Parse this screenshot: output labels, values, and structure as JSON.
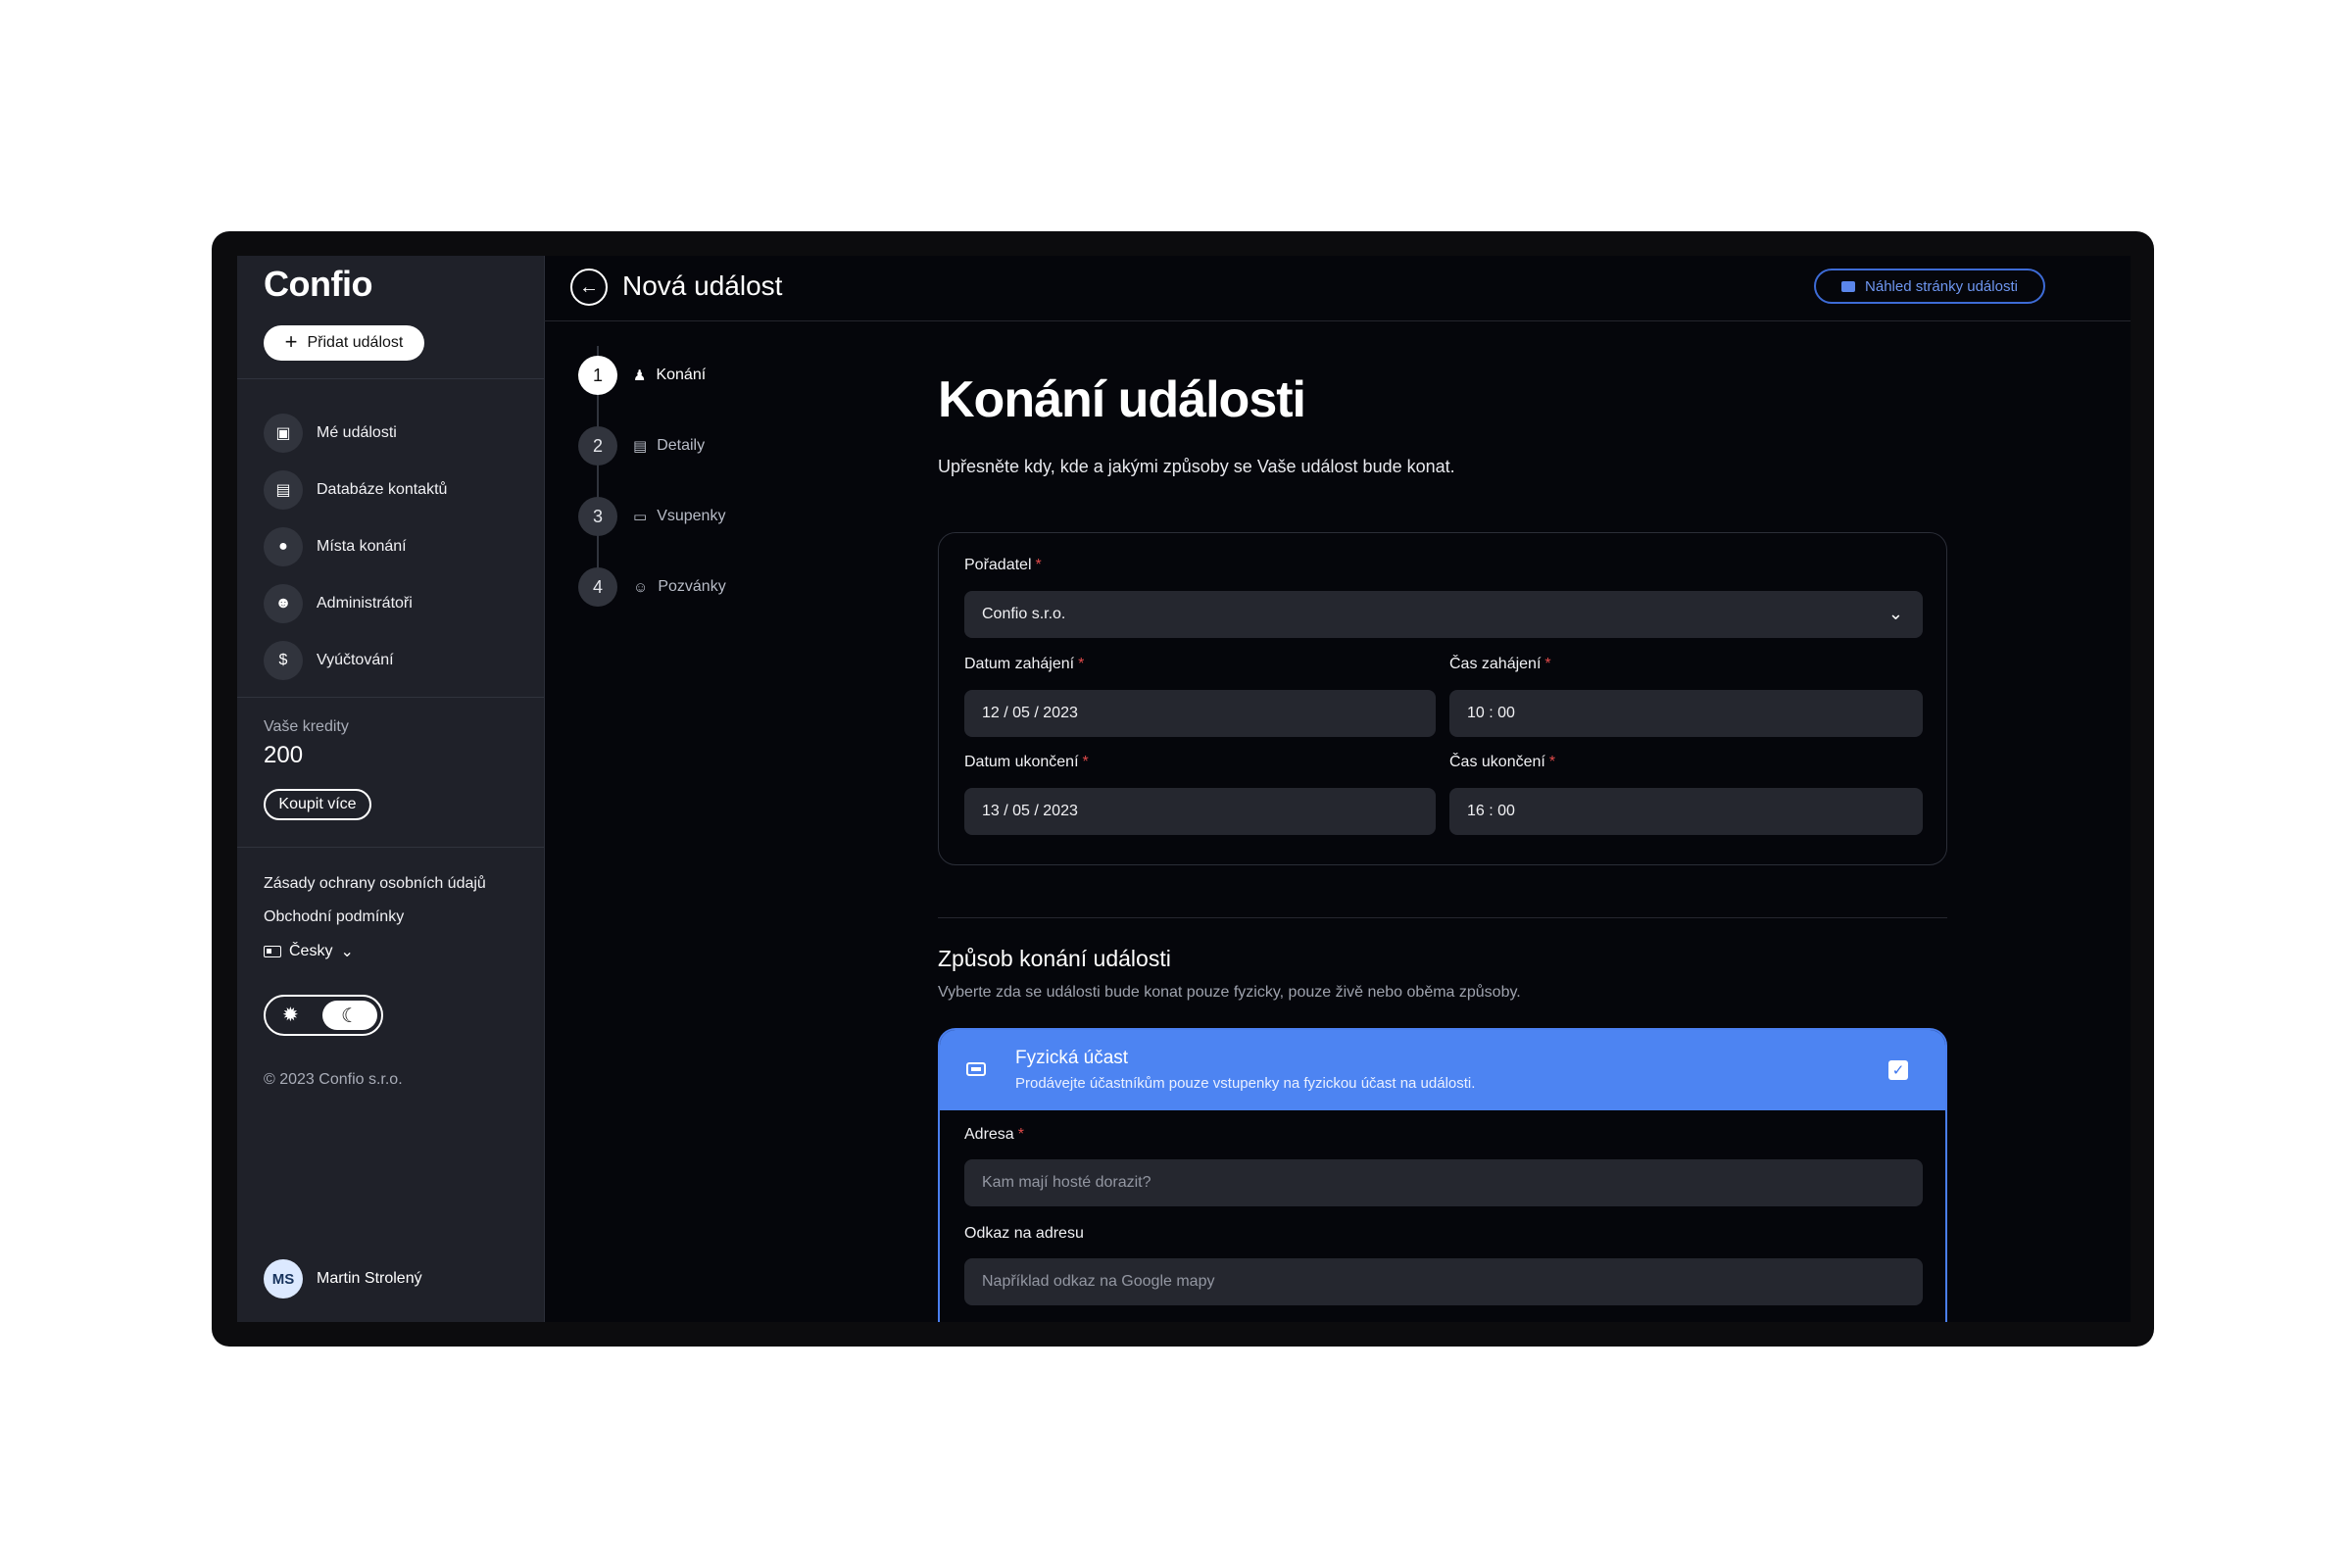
{
  "sidebar": {
    "logo": "Confio",
    "add_event_label": "Přidat událost",
    "nav": [
      {
        "label": "Mé události",
        "icon": "calendar-icon"
      },
      {
        "label": "Databáze kontaktů",
        "icon": "contacts-icon"
      },
      {
        "label": "Místa konání",
        "icon": "location-pin-icon"
      },
      {
        "label": "Administrátoři",
        "icon": "admin-user-icon"
      },
      {
        "label": "Vyúčtování",
        "icon": "dollar-icon"
      }
    ],
    "credits_label": "Vaše kredity",
    "credits_value": "200",
    "buy_more_label": "Koupit více",
    "privacy_link": "Zásady ochrany osobních údajů",
    "terms_link": "Obchodní podmínky",
    "language": "Česky",
    "copyright": "© 2023 Confio s.r.o.",
    "user": {
      "initials": "MS",
      "name": "Martin Strolený"
    }
  },
  "header": {
    "title": "Nová událost",
    "preview_label": "Náhled stránky události"
  },
  "steps": [
    {
      "number": "1",
      "label": "Konání",
      "active": true
    },
    {
      "number": "2",
      "label": "Detaily",
      "active": false
    },
    {
      "number": "3",
      "label": "Vsupenky",
      "active": false
    },
    {
      "number": "4",
      "label": "Pozvánky",
      "active": false
    }
  ],
  "main": {
    "title": "Konání události",
    "description": "Upřesněte kdy, kde a jakými způsoby se Vaše událost bude konat.",
    "organizer_label": "Pořadatel",
    "organizer_value": "Confio s.r.o.",
    "start_date_label": "Datum zahájení",
    "start_date_value": "12 / 05 / 2023",
    "start_time_label": "Čas zahájení",
    "start_time_value": "10 : 00",
    "end_date_label": "Datum ukončení",
    "end_date_value": "13 / 05 / 2023",
    "end_time_label": "Čas ukončení",
    "end_time_value": "16 : 00",
    "required_mark": "*",
    "mode_section_title": "Způsob konání události",
    "mode_section_desc": "Vyberte zda se události bude konat pouze fyzicky, pouze živě nebo oběma způsoby.",
    "mode": {
      "title": "Fyzická účast",
      "description": "Prodávejte účastníkům pouze vstupenky na fyzickou účast na události.",
      "checked": true
    },
    "address_label": "Adresa",
    "address_placeholder": "Kam mají hosté dorazit?",
    "address_link_label": "Odkaz na adresu",
    "address_link_placeholder": "Například odkaz na Google mapy"
  },
  "colors": {
    "accent": "#4d84f2",
    "background": "#05060b",
    "sidebar": "#1f2129",
    "required": "#e04a4a"
  }
}
